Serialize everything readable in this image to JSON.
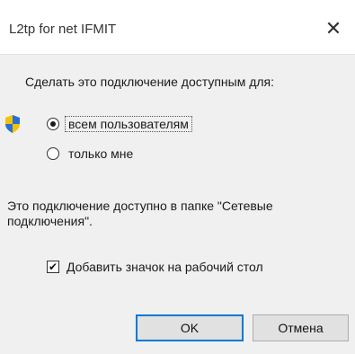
{
  "dialog": {
    "title": "L2tp for net IFMIT",
    "close_glyph": "✕",
    "prompt": "Сделать это подключение доступным для:",
    "radio_options": [
      {
        "label": "всем пользователям",
        "checked": true,
        "icon": "uac-shield-icon"
      },
      {
        "label": "только мне",
        "checked": false
      }
    ],
    "info_text": "Это подключение доступно в папке \"Сетевые подключения\".",
    "checkbox": {
      "label": "Добавить значок на рабочий стол",
      "checked": true,
      "check_glyph": "✔"
    },
    "buttons": {
      "ok_label": "OK",
      "cancel_label": "Отмена"
    },
    "accent_color": "#0078d7"
  }
}
